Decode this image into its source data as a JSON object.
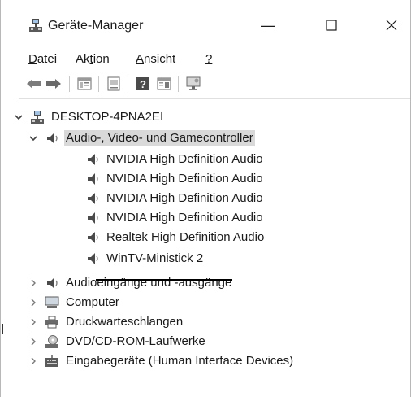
{
  "window": {
    "title": "Geräte-Manager",
    "min_glyph": "—",
    "max_glyph": "☐",
    "close_glyph": "✕"
  },
  "menu": {
    "datei": {
      "accel": "D",
      "rest": "atei"
    },
    "aktion": {
      "pre": "Ak",
      "accel": "t",
      "rest": "ion"
    },
    "ansicht": {
      "accel": "A",
      "rest": "nsicht"
    },
    "help": {
      "accel": "?"
    }
  },
  "toolbar": {
    "icons": [
      "back-arrow-icon",
      "forward-arrow-icon",
      "properties-icon",
      "update-driver-icon",
      "help-icon",
      "view-icon",
      "monitor-icon"
    ]
  },
  "tree": {
    "root": {
      "label": "DESKTOP-4PNA2EI",
      "icon": "computer-tree-icon",
      "expanded": true
    },
    "category_audio": {
      "label": "Audio-, Video- und Gamecontroller",
      "icon": "speaker-icon",
      "expanded": true,
      "selected": true
    },
    "audio_devices": [
      {
        "label": "NVIDIA High Definition Audio",
        "icon": "speaker-icon"
      },
      {
        "label": "NVIDIA High Definition Audio",
        "icon": "speaker-icon"
      },
      {
        "label": "NVIDIA High Definition Audio",
        "icon": "speaker-icon"
      },
      {
        "label": "NVIDIA High Definition Audio",
        "icon": "speaker-icon"
      },
      {
        "label": "Realtek High Definition Audio",
        "icon": "speaker-icon"
      },
      {
        "label": "WinTV-Ministick 2",
        "icon": "speaker-icon"
      }
    ],
    "other_categories": [
      {
        "label": "Audioeingänge und -ausgänge",
        "icon": "speaker-icon"
      },
      {
        "label": "Computer",
        "icon": "monitor-icon"
      },
      {
        "label": "Druckwarteschlangen",
        "icon": "printer-icon"
      },
      {
        "label": "DVD/CD-ROM-Laufwerke",
        "icon": "disc-drive-icon"
      },
      {
        "label": "Eingabegeräte (Human Interface Devices)",
        "icon": "keyboard-icon"
      }
    ]
  },
  "colors": {
    "selection": "#d9d9d9",
    "expander": "#6a6a6a"
  }
}
